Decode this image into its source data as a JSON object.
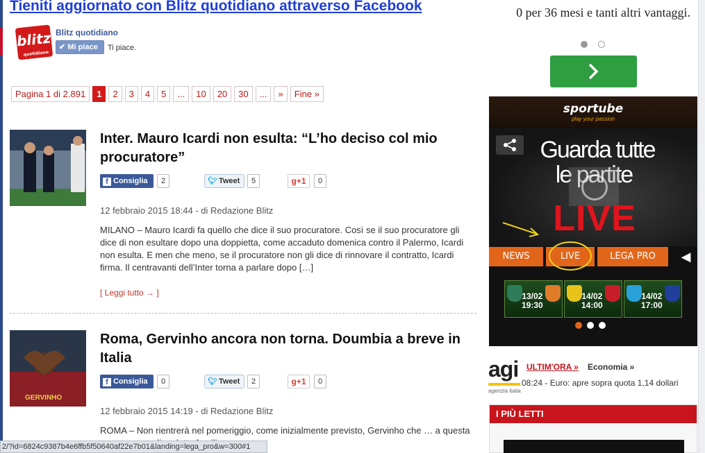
{
  "main": {
    "fb_promo": "Tieniti aggiornato con Blitz quotidiano attraverso Facebook",
    "fb_box": {
      "logo_text": "blitz",
      "logo_sub": "quotidiano",
      "page_name": "Blitz quotidiano",
      "like_label": "Mi piace",
      "like_note": "Ti piace."
    },
    "pagination": {
      "info": "Pagina 1 di 2.891",
      "pages": [
        "1",
        "2",
        "3",
        "4",
        "5",
        "...",
        "10",
        "20",
        "30",
        "...",
        "»",
        "Fine »"
      ],
      "current": "1"
    },
    "articles": [
      {
        "title": "Inter. Mauro Icardi non esulta: “L’ho deciso col mio procuratore”",
        "fb_label": "Consiglia",
        "fb_count": "2",
        "tweet_label": "Tweet",
        "tweet_count": "5",
        "gplus_label": "+1",
        "gplus_count": "0",
        "meta": "12 febbraio 2015 18:44 - di Redazione Blitz",
        "excerpt": "MILANO – Mauro Icardi fa quello che dice il suo procuratore. Così se il suo procuratore gli dice di non esultare dopo una doppietta, come accaduto domenica contro il Palermo, Icardi non esulta. E men che meno, se il procuratore non gli dice di rinnovare il contratto, Icardi firma. Il centravanti dell’Inter torna a parlare dopo […]",
        "readmore": "[ Leggi tutto → ]"
      },
      {
        "title": "Roma, Gervinho ancora non torna. Doumbia a breve in Italia",
        "fb_label": "Consiglia",
        "fb_count": "0",
        "tweet_label": "Tweet",
        "tweet_count": "2",
        "gplus_label": "+1",
        "gplus_count": "0",
        "meta": "12 febbraio 2015 14:19 - di Redazione Blitz",
        "excerpt": "ROMA – Non rientrerà nel pomeriggio, come inizialmente previsto, Gervinho che … a questa sera a causa di un lutto familiare.",
        "jersey": "GERVINHO"
      }
    ]
  },
  "statusbar": {
    "url": "2/?id=6824c9387b4e6ffb5f50640af22e7b01&landing=lega_pro&w=300#1"
  },
  "sidebar": {
    "promo_text": "0 per 36 mesi e tanti altri vantaggi.",
    "sportube": {
      "logo": "sportube",
      "tagline": "play your passion",
      "headline_1": "Guarda tutte",
      "headline_2": "le partite",
      "headline_live": "LIVE",
      "tabs": [
        "NEWS",
        "LIVE",
        "LEGA PRO"
      ],
      "matches": [
        {
          "date": "13/02",
          "time": "19:30",
          "home_color": "#2e7d5a",
          "away_color": "#e07b2a"
        },
        {
          "date": "14/02",
          "time": "14:00",
          "home_color": "#e8c41a",
          "away_color": "#c81e2a"
        },
        {
          "date": "14/02",
          "time": "17:00",
          "home_color": "#2aa0d8",
          "away_color": "#1f3f9a"
        }
      ]
    },
    "agi": {
      "logo": "agi",
      "sub": "agenzia italia",
      "ultimora": "ULTIM'ORA »",
      "section": "Economia »",
      "news": "08:24 - Euro: apre sopra quota 1,14 dollari"
    },
    "piu_letti": "I PIÙ LETTI"
  },
  "colors": {
    "accent_red": "#d21a1a",
    "facebook_blue": "#3b5998",
    "sportube_orange": "#e2661a",
    "cta_green": "#2e9e41"
  }
}
